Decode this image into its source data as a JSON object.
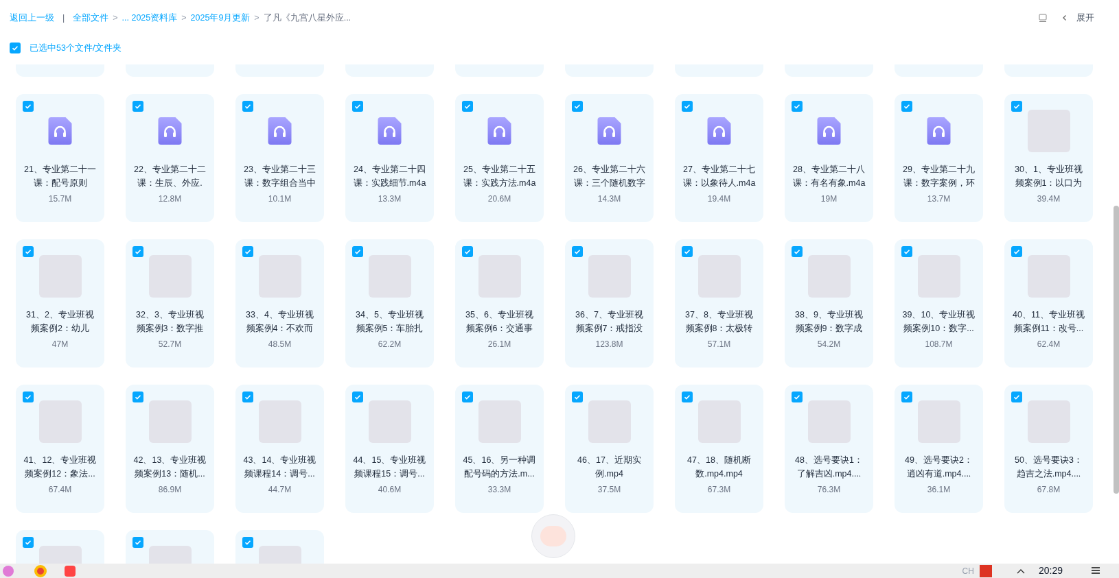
{
  "breadcrumb": {
    "back": "返回上一级",
    "separator": "|",
    "items": [
      {
        "label": "全部文件",
        "current": false
      },
      {
        "label": "... 2025资料库",
        "current": false
      },
      {
        "label": "2025年9月更新",
        "current": false
      },
      {
        "label": "了凡《九宫八星外应...",
        "current": true
      }
    ],
    "arrow": ">"
  },
  "expand": {
    "label": "展开"
  },
  "selection": {
    "checked": true,
    "label": "已选中53个文件/文件夹"
  },
  "files": [
    {
      "kind": "clipped"
    },
    {
      "kind": "clipped"
    },
    {
      "kind": "clipped"
    },
    {
      "kind": "clipped"
    },
    {
      "kind": "clipped"
    },
    {
      "kind": "clipped"
    },
    {
      "kind": "clipped"
    },
    {
      "kind": "clipped"
    },
    {
      "kind": "clipped"
    },
    {
      "kind": "clipped"
    },
    {
      "kind": "audio",
      "selected": true,
      "name": "21、专业第二十一课：配号原则",
      "size": "15.7M"
    },
    {
      "kind": "audio",
      "selected": true,
      "name": "22、专业第二十二课：生辰、外应.",
      "size": "12.8M"
    },
    {
      "kind": "audio",
      "selected": true,
      "name": "23、专业第二十三课：数字组合当中",
      "size": "10.1M"
    },
    {
      "kind": "audio",
      "selected": true,
      "name": "24、专业第二十四课：实践细节.m4a",
      "size": "13.3M"
    },
    {
      "kind": "audio",
      "selected": true,
      "name": "25、专业第二十五课：实践方法.m4a",
      "size": "20.6M"
    },
    {
      "kind": "audio",
      "selected": true,
      "name": "26、专业第二十六课：三个随机数字",
      "size": "14.3M"
    },
    {
      "kind": "audio",
      "selected": true,
      "name": "27、专业第二十七课：以象待人.m4a",
      "size": "19.4M"
    },
    {
      "kind": "audio",
      "selected": true,
      "name": "28、专业第二十八课：有名有象.m4a",
      "size": "19M"
    },
    {
      "kind": "audio",
      "selected": true,
      "name": "29、专业第二十九课：数字案例，环",
      "size": "13.7M"
    },
    {
      "kind": "video",
      "selected": true,
      "name": "30、1、专业班视频案例1：以口为",
      "size": "39.4M"
    },
    {
      "kind": "video",
      "selected": true,
      "name": "31、2、专业班视频案例2：幼儿",
      "size": "47M"
    },
    {
      "kind": "video",
      "selected": true,
      "name": "32、3、专业班视频案例3：数字推",
      "size": "52.7M"
    },
    {
      "kind": "video",
      "selected": true,
      "name": "33、4、专业班视频案例4：不欢而",
      "size": "48.5M"
    },
    {
      "kind": "video",
      "selected": true,
      "name": "34、5、专业班视频案例5：车胎扎",
      "size": "62.2M"
    },
    {
      "kind": "video",
      "selected": true,
      "name": "35、6、专业班视频案例6：交通事",
      "size": "26.1M"
    },
    {
      "kind": "video",
      "selected": true,
      "name": "36、7、专业班视频案例7：戒指没",
      "size": "123.8M"
    },
    {
      "kind": "video",
      "selected": true,
      "name": "37、8、专业班视频案例8：太极转",
      "size": "57.1M"
    },
    {
      "kind": "video",
      "selected": true,
      "name": "38、9、专业班视频案例9：数字成",
      "size": "54.2M"
    },
    {
      "kind": "video",
      "selected": true,
      "name": "39、10、专业班视频案例10：数字...",
      "size": "108.7M"
    },
    {
      "kind": "video",
      "selected": true,
      "name": "40、11、专业班视频案例11：改号...",
      "size": "62.4M"
    },
    {
      "kind": "video",
      "selected": true,
      "name": "41、12、专业班视频案例12：象法...",
      "size": "67.4M"
    },
    {
      "kind": "video",
      "selected": true,
      "name": "42、13、专业班视频案例13：随机...",
      "size": "86.9M"
    },
    {
      "kind": "video",
      "selected": true,
      "name": "43、14、专业班视频课程14：调号...",
      "size": "44.7M"
    },
    {
      "kind": "video",
      "selected": true,
      "name": "44、15、专业班视频课程15：调号...",
      "size": "40.6M"
    },
    {
      "kind": "video",
      "selected": true,
      "name": "45、16、另一种调配号码的方法.m...",
      "size": "33.3M"
    },
    {
      "kind": "video",
      "selected": true,
      "name": "46、17、近期实例.mp4",
      "size": "37.5M"
    },
    {
      "kind": "video",
      "selected": true,
      "name": "47、18、随机断数.mp4.mp4",
      "size": "67.3M"
    },
    {
      "kind": "video",
      "selected": true,
      "name": "48、选号要诀1：了解吉凶.mp4....",
      "size": "76.3M"
    },
    {
      "kind": "video",
      "selected": true,
      "name": "49、选号要诀2：逍凶有道.mp4....",
      "size": "36.1M"
    },
    {
      "kind": "video",
      "selected": true,
      "name": "50、选号要诀3：趋吉之法.mp4....",
      "size": "67.8M"
    },
    {
      "kind": "video",
      "selected": true
    },
    {
      "kind": "video",
      "selected": true
    },
    {
      "kind": "video",
      "selected": true
    }
  ],
  "taskbar": {
    "language": "CH",
    "time": "20:29"
  }
}
